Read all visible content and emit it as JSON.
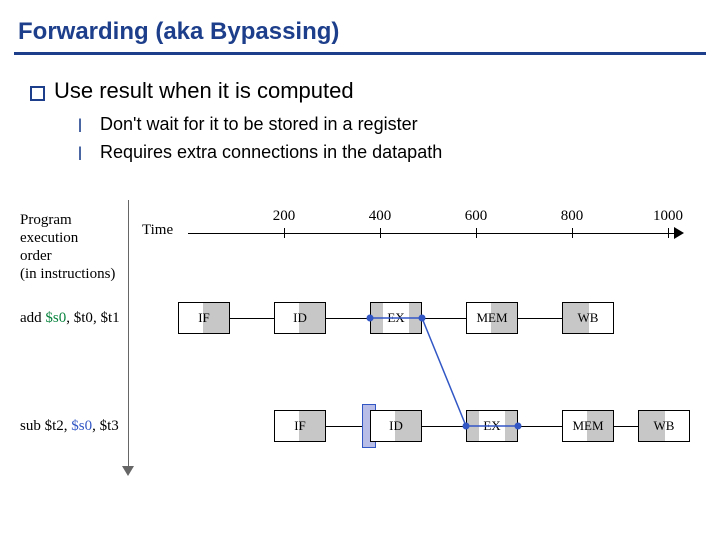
{
  "title": "Forwarding (aka Bypassing)",
  "bullets": {
    "main": "Use result when it is computed",
    "subs": [
      "Don't wait for it to be stored in a register",
      "Requires extra connections in the datapath"
    ]
  },
  "diagram": {
    "y_label_line1": "Program",
    "y_label_line2": "execution",
    "y_label_line3": "order",
    "y_label_line4": "(in instructions)",
    "time_label": "Time",
    "ticks": [
      "200",
      "400",
      "600",
      "800",
      "1000"
    ],
    "instr1": {
      "op": "add",
      "rd": "$s0",
      "rs": "$t0",
      "rt": "$t1"
    },
    "instr2": {
      "op": "sub",
      "rd": "$t2",
      "rs": "$s0",
      "rt": "$t3"
    },
    "sep": ", ",
    "stages": [
      "IF",
      "ID",
      "EX",
      "MEM",
      "WB"
    ]
  }
}
